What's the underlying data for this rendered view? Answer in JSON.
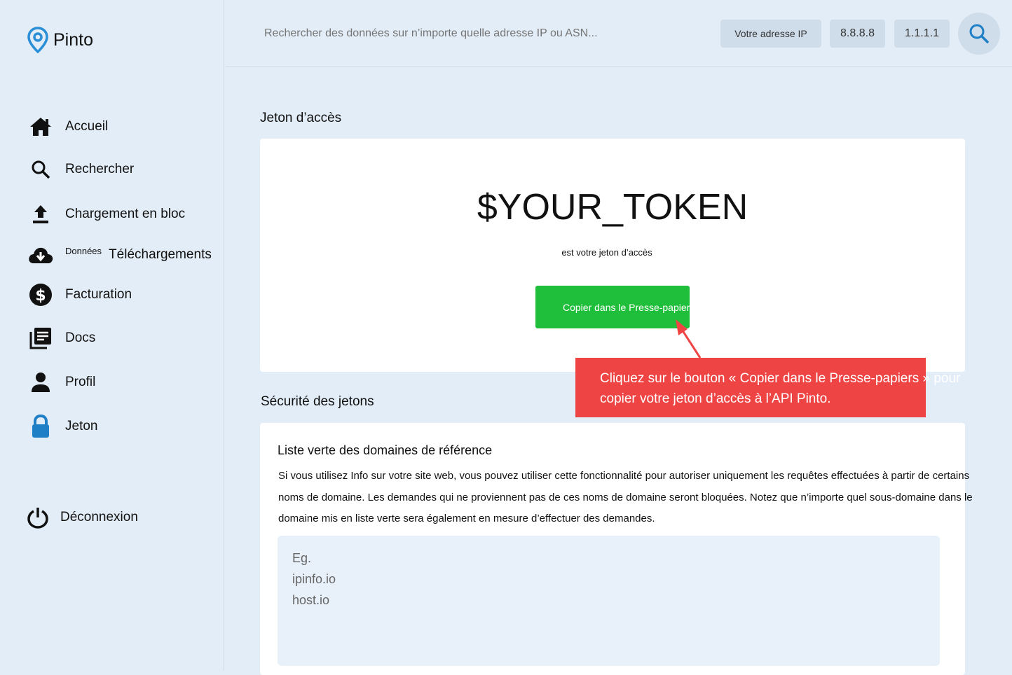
{
  "app": {
    "name": "Pinto"
  },
  "sidebar": {
    "items": [
      {
        "label": "Accueil",
        "icon": "home-icon"
      },
      {
        "label": "Rechercher",
        "icon": "search-icon"
      },
      {
        "label": "Chargement en bloc",
        "icon": "upload-icon"
      },
      {
        "prefix": "Données",
        "label": "Téléchargements",
        "icon": "cloud-download-icon"
      },
      {
        "label": "Facturation",
        "icon": "dollar-icon"
      },
      {
        "label": "Docs",
        "icon": "docs-icon"
      },
      {
        "label": "Profil",
        "icon": "person-icon"
      },
      {
        "label": "Jeton",
        "icon": "lock-icon"
      }
    ],
    "logout": {
      "label": "Déconnexion",
      "icon": "power-icon"
    }
  },
  "topbar": {
    "search_placeholder": "Rechercher des données sur n’importe quelle adresse IP ou ASN...",
    "chips": [
      "Votre adresse IP",
      "8.8.8.8",
      "1.1.1.1"
    ]
  },
  "token_section": {
    "title": "Jeton d’accès",
    "token": "$YOUR_TOKEN",
    "subtitle": "est votre jeton d’accès",
    "copy_label": "Copier dans le Presse-papiers"
  },
  "callout": {
    "text": "Cliquez sur le bouton « Copier dans le Presse-papiers » pour copier votre jeton d’accès à l’API Pinto."
  },
  "security_section": {
    "title": "Sécurité des jetons",
    "card_title": "Liste verte des domaines de référence",
    "description": "Si vous utilisez Info sur votre site web, vous pouvez utiliser cette fonctionnalité pour autoriser uniquement les requêtes effectuées à partir de certains noms de domaine. Les demandes qui ne proviennent pas de ces noms de domaine seront bloquées. Notez que n’importe quel sous-domaine dans le domaine mis en liste verte sera également en mesure d’effectuer des demandes.",
    "placeholder_lines": [
      "Eg.",
      "ipinfo.io",
      "host.io"
    ]
  },
  "colors": {
    "background": "#e3edf7",
    "accent": "#1f7fc6",
    "copy_button": "#1fbe3b",
    "callout": "#ef4444",
    "chip": "#cfdcea"
  }
}
